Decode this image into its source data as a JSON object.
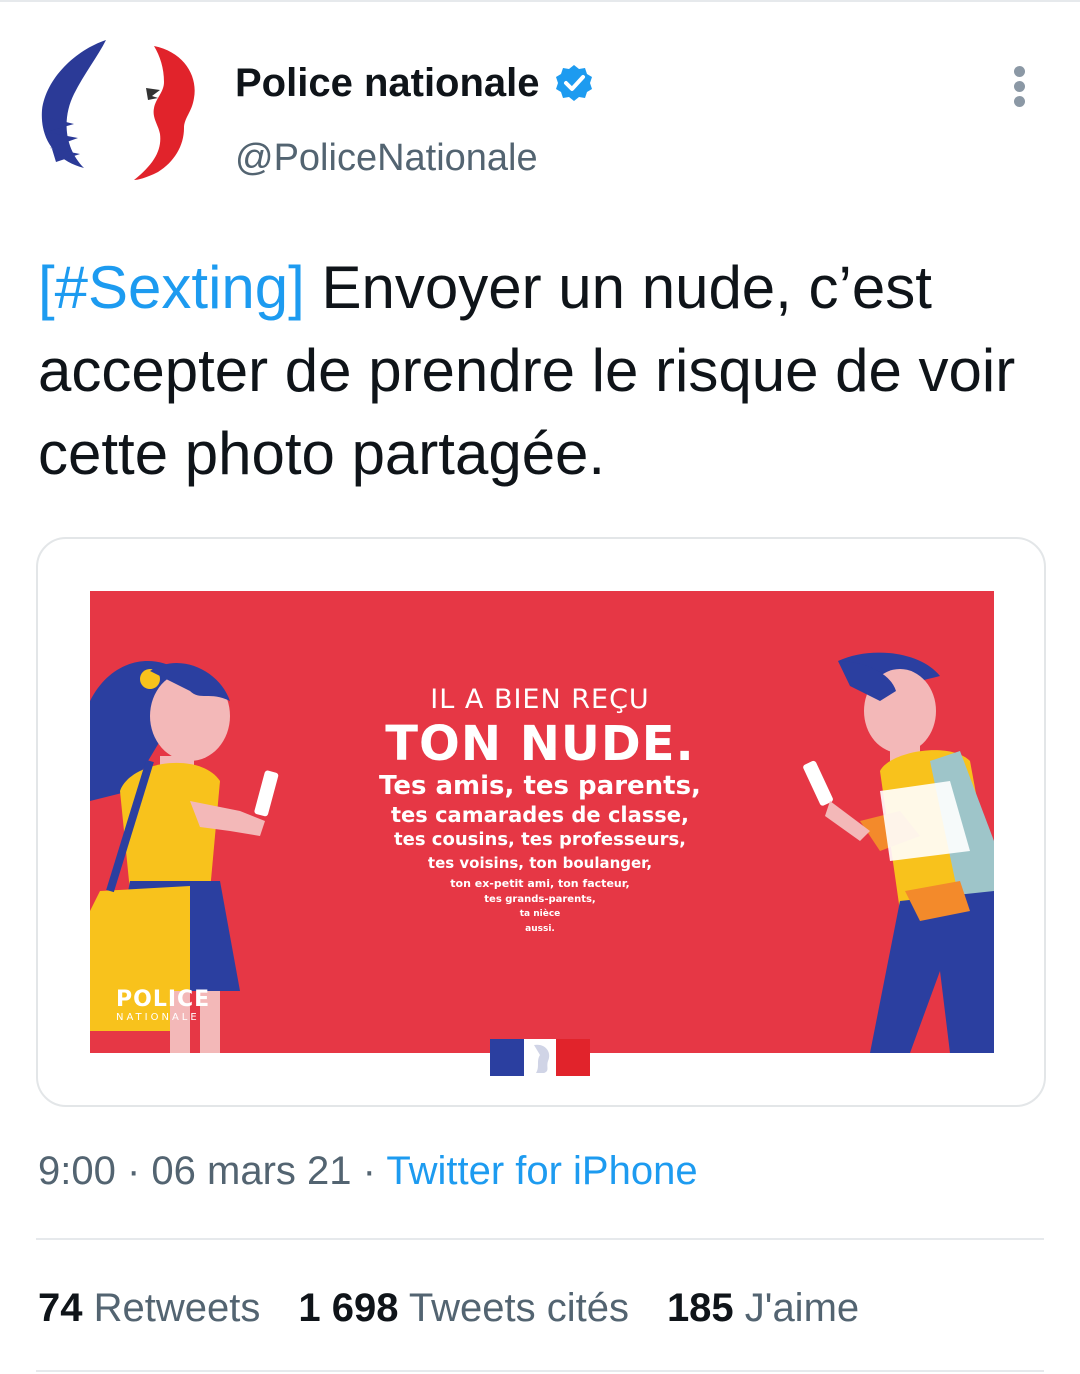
{
  "author": {
    "display_name": "Police nationale",
    "handle": "@PoliceNationale",
    "verified": true,
    "avatar_icon": "marianne-logo-icon"
  },
  "tweet": {
    "hashtag": "[#Sexting]",
    "text": " Envoyer un nude, c’est accepter de prendre le risque de voir cette photo partagée."
  },
  "media": {
    "line1": "IL A BIEN REÇU",
    "line2": "TON NUDE.",
    "line3": "Tes amis, tes parents,",
    "line4": "tes camarades de classe,",
    "line5": "tes cousins, tes professeurs,",
    "line6": "tes voisins, ton boulanger,",
    "line7": "ton ex-petit ami, ton facteur,",
    "line8": "tes grands-parents,",
    "line9": "ta nièce",
    "line10": "aussi.",
    "logo_line1": "POLICE",
    "logo_line2": "NATIONALE"
  },
  "meta": {
    "time": "9:00",
    "sep1": " · ",
    "date": "06 mars 21",
    "sep2": " · ",
    "source": "Twitter for iPhone"
  },
  "stats": {
    "retweets_count": "74",
    "retweets_label": " Retweets",
    "quotes_count": "1 698",
    "quotes_label": " Tweets cités",
    "likes_count": "185",
    "likes_label": " J'aime"
  },
  "colors": {
    "poster_red": "#e63745",
    "link_blue": "#1d9bf0",
    "muted_text": "#536471"
  }
}
